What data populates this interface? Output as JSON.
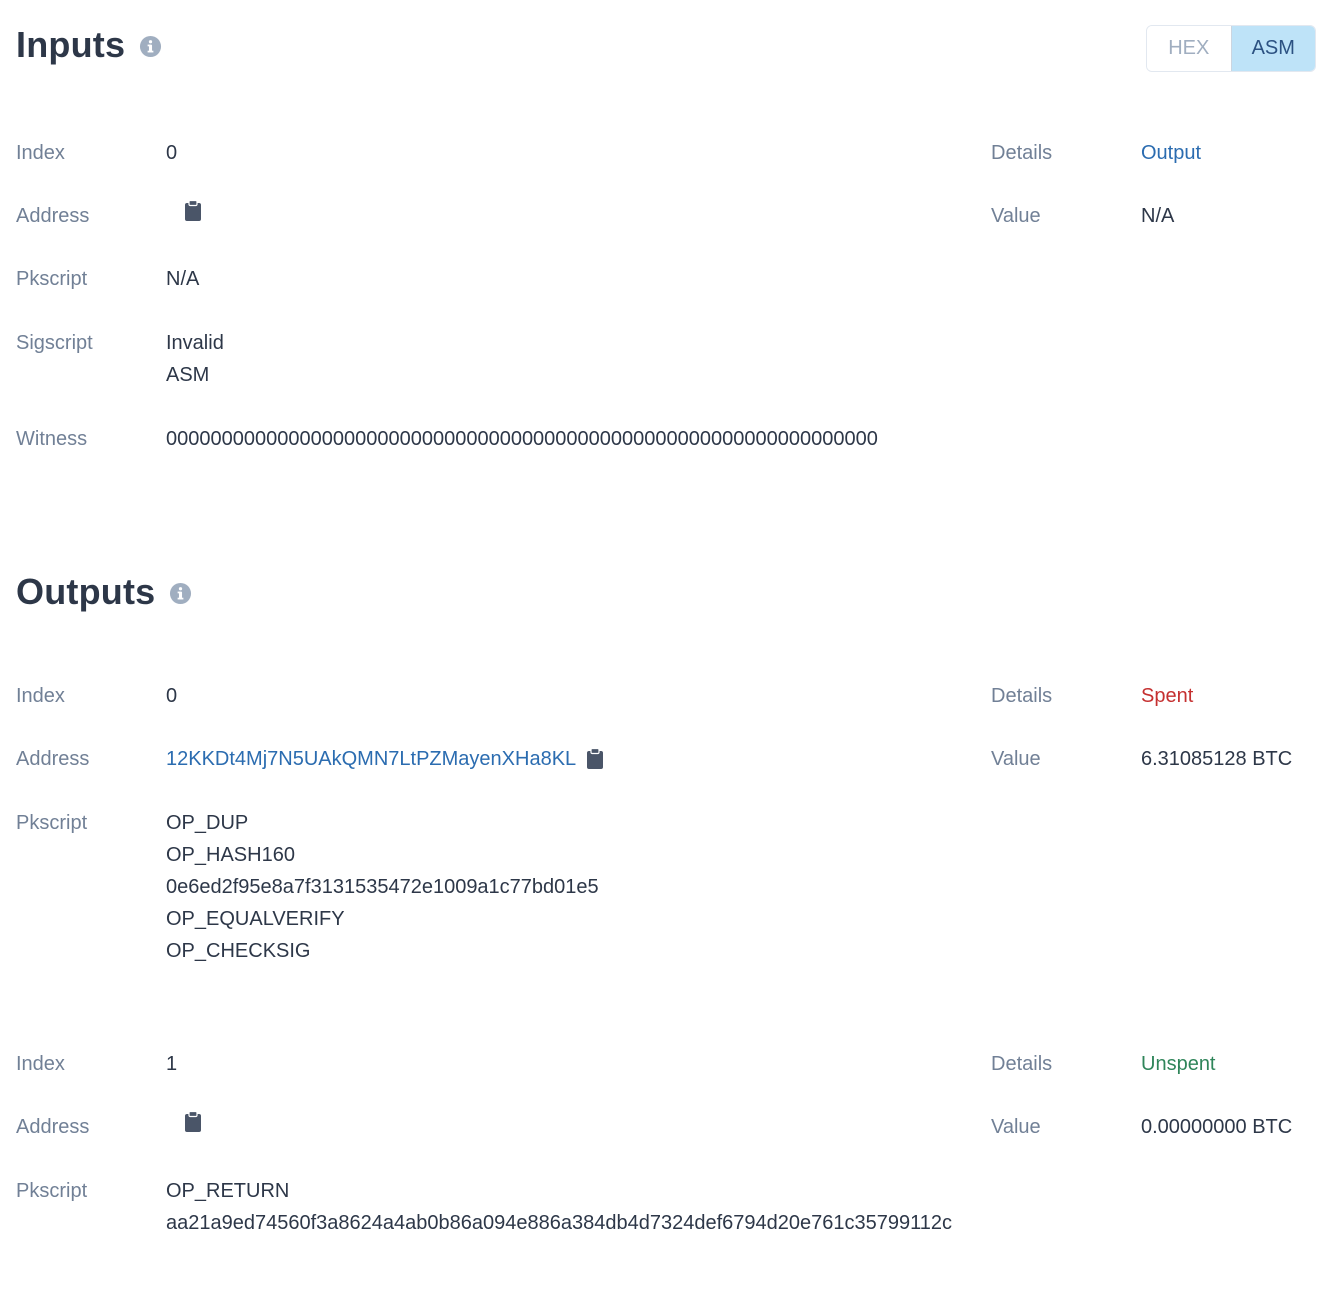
{
  "inputs": {
    "title": "Inputs",
    "toggle": {
      "hex": "HEX",
      "asm": "ASM",
      "selected": "ASM"
    },
    "labels": {
      "index": "Index",
      "address": "Address",
      "pkscript": "Pkscript",
      "sigscript": "Sigscript",
      "witness": "Witness",
      "details": "Details",
      "value": "Value"
    },
    "items": [
      {
        "index": "0",
        "address": "",
        "pkscript": "N/A",
        "sigscript": [
          "Invalid",
          "ASM"
        ],
        "witness": "0000000000000000000000000000000000000000000000000000000000000000",
        "details": "Output",
        "value": "N/A"
      }
    ]
  },
  "outputs": {
    "title": "Outputs",
    "labels": {
      "index": "Index",
      "address": "Address",
      "pkscript": "Pkscript",
      "details": "Details",
      "value": "Value"
    },
    "items": [
      {
        "index": "0",
        "address": "12KKDt4Mj7N5UAkQMN7LtPZMayenXHa8KL",
        "pkscript": [
          "OP_DUP",
          "OP_HASH160",
          "0e6ed2f95e8a7f3131535472e1009a1c77bd01e5",
          "OP_EQUALVERIFY",
          "OP_CHECKSIG"
        ],
        "details": "Spent",
        "details_color": "#c53030",
        "value": "6.31085128 BTC"
      },
      {
        "index": "1",
        "address": "",
        "pkscript": [
          "OP_RETURN",
          "aa21a9ed74560f3a8624a4ab0b86a094e886a384db4d7324def6794d20e761c35799112c"
        ],
        "details": "Unspent",
        "details_color": "#2f855a",
        "value": "0.00000000 BTC"
      }
    ]
  },
  "colors": {
    "link": "#2b6cb0",
    "label": "#718096",
    "text": "#2d3748",
    "toggle_active_bg": "#bee3f8"
  }
}
